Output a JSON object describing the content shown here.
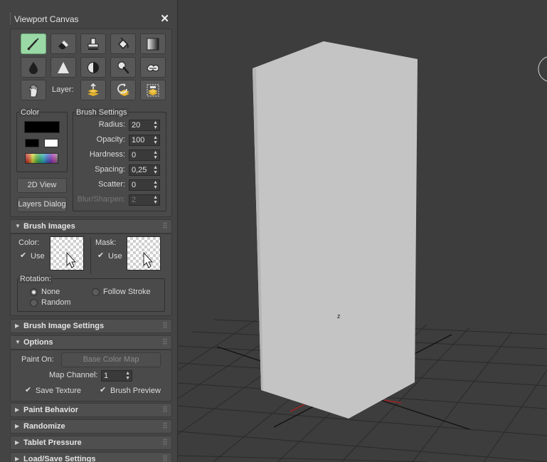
{
  "window": {
    "title": "Viewport Canvas"
  },
  "toolbar": {
    "tools": [
      {
        "name": "paint-brush-icon",
        "active": true
      },
      {
        "name": "eraser-icon"
      },
      {
        "name": "clone-stamp-icon"
      },
      {
        "name": "fill-bucket-icon"
      },
      {
        "name": "gradient-icon"
      },
      {
        "name": "blur-drop-icon"
      },
      {
        "name": "sharpen-triangle-icon"
      },
      {
        "name": "contrast-icon"
      },
      {
        "name": "dodge-burn-icon"
      },
      {
        "name": "smudge-icon"
      },
      {
        "name": "pan-hand-icon"
      }
    ],
    "layer_label": "Layer:",
    "layer_tools": [
      "layer-add-icon",
      "layer-refresh-icon",
      "layer-properties-icon"
    ]
  },
  "color": {
    "label": "Color",
    "primary": "#000000",
    "secondary_black": "#000000",
    "secondary_white": "#ffffff"
  },
  "brush_settings": {
    "label": "Brush Settings",
    "fields": [
      {
        "label": "Radius:",
        "value": "20"
      },
      {
        "label": "Opacity:",
        "value": "100"
      },
      {
        "label": "Hardness:",
        "value": "0"
      },
      {
        "label": "Spacing:",
        "value": "0,25"
      },
      {
        "label": "Scatter:",
        "value": "0"
      },
      {
        "label": "Blur/Sharpen:",
        "value": "2",
        "disabled": true
      }
    ]
  },
  "buttons": {
    "view2d": "2D View",
    "layers_dialog": "Layers Dialog"
  },
  "brush_images": {
    "title": "Brush Images",
    "color_label": "Color:",
    "mask_label": "Mask:",
    "use_label": "Use",
    "rotation_label": "Rotation:",
    "rotation_options": [
      {
        "label": "None",
        "checked": true
      },
      {
        "label": "Follow Stroke"
      },
      {
        "label": "Random"
      }
    ]
  },
  "rollouts": {
    "brush_image_settings": "Brush Image Settings",
    "options": "Options",
    "paint_behavior": "Paint Behavior",
    "randomize": "Randomize",
    "tablet_pressure": "Tablet Pressure",
    "load_save": "Load/Save Settings"
  },
  "options": {
    "paint_on_label": "Paint On:",
    "paint_on_value": "Base Color Map",
    "map_channel_label": "Map Channel:",
    "map_channel_value": "1",
    "save_texture": "Save Texture",
    "brush_preview": "Brush Preview"
  },
  "viewport": {
    "gizmo_label": "z",
    "box_color": "#c4c4c4",
    "grid_color": "#262626",
    "axis_color": "#a02222"
  }
}
